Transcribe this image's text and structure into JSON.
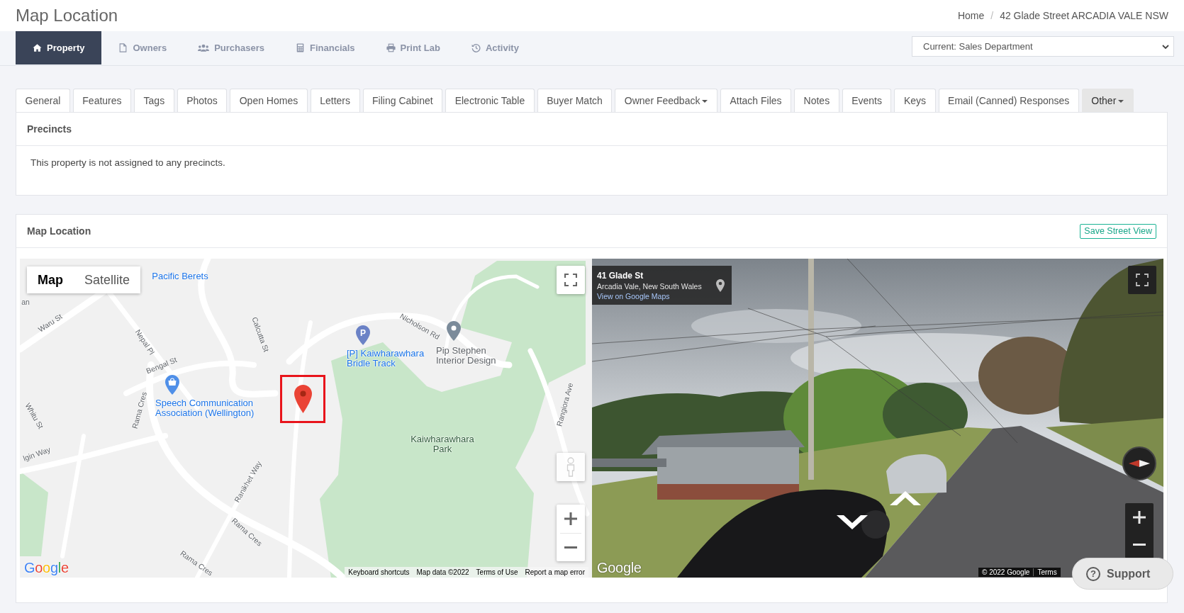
{
  "header": {
    "title": "Map Location",
    "breadcrumb": {
      "items": [
        "Home",
        "42 Glade Street ARCADIA VALE NSW"
      ],
      "separator": "/"
    }
  },
  "nav": {
    "items": [
      {
        "label": "Property",
        "selected": true
      },
      {
        "label": "Owners",
        "selected": false
      },
      {
        "label": "Purchasers",
        "selected": false
      },
      {
        "label": "Financials",
        "selected": false
      },
      {
        "label": "Print Lab",
        "selected": false
      },
      {
        "label": "Activity",
        "selected": false
      }
    ],
    "department_select": {
      "value": "Current: Sales Department"
    }
  },
  "tabs": [
    {
      "label": "General",
      "selected": false,
      "dropdown": false
    },
    {
      "label": "Features",
      "selected": false,
      "dropdown": false
    },
    {
      "label": "Tags",
      "selected": false,
      "dropdown": false
    },
    {
      "label": "Photos",
      "selected": false,
      "dropdown": false
    },
    {
      "label": "Open Homes",
      "selected": false,
      "dropdown": false
    },
    {
      "label": "Letters",
      "selected": false,
      "dropdown": false
    },
    {
      "label": "Filing Cabinet",
      "selected": false,
      "dropdown": false
    },
    {
      "label": "Electronic Table",
      "selected": false,
      "dropdown": false
    },
    {
      "label": "Buyer Match",
      "selected": false,
      "dropdown": false
    },
    {
      "label": "Owner Feedback",
      "selected": false,
      "dropdown": true
    },
    {
      "label": "Attach Files",
      "selected": false,
      "dropdown": false
    },
    {
      "label": "Notes",
      "selected": false,
      "dropdown": false
    },
    {
      "label": "Events",
      "selected": false,
      "dropdown": false
    },
    {
      "label": "Keys",
      "selected": false,
      "dropdown": false
    },
    {
      "label": "Email (Canned) Responses",
      "selected": false,
      "dropdown": false
    },
    {
      "label": "Other",
      "selected": true,
      "dropdown": true
    }
  ],
  "precincts": {
    "title": "Precincts",
    "message": "This property is not assigned to any precincts."
  },
  "map_location": {
    "title": "Map Location",
    "save_button": "Save Street View"
  },
  "map": {
    "type_buttons": [
      {
        "label": "Map",
        "selected": true
      },
      {
        "label": "Satellite",
        "selected": false
      }
    ],
    "labels": [
      {
        "text": "Pacific Berets",
        "kind": "poi"
      },
      {
        "text": "an",
        "kind": "street"
      },
      {
        "text": "Waru St",
        "kind": "street"
      },
      {
        "text": "Nepal Pl",
        "kind": "street"
      },
      {
        "text": "Calcutta St",
        "kind": "street"
      },
      {
        "text": "Nicholson Rd",
        "kind": "street"
      },
      {
        "text": "[P] Kaiwharawhara Bridle Track",
        "kind": "poi"
      },
      {
        "text": "Pip Stephen Interior Design",
        "kind": "place"
      },
      {
        "text": "Bengal St",
        "kind": "street"
      },
      {
        "text": "Speech Communication Association (Wellington)",
        "kind": "poi"
      },
      {
        "text": "Rama Cres",
        "kind": "street"
      },
      {
        "text": "Whitu St",
        "kind": "street"
      },
      {
        "text": "Kaiwharawhara Park",
        "kind": "park"
      },
      {
        "text": "Rangiora Ave",
        "kind": "street"
      },
      {
        "text": "lgin Way",
        "kind": "street"
      },
      {
        "text": "Ranikhet Way",
        "kind": "street"
      },
      {
        "text": "Rama Cres",
        "kind": "street"
      },
      {
        "text": "Rama Cres",
        "kind": "street"
      }
    ],
    "markers": [
      {
        "kind": "shop"
      },
      {
        "kind": "parking",
        "label": "P"
      },
      {
        "kind": "place"
      },
      {
        "kind": "property"
      }
    ],
    "logo": "Google",
    "footer_links": [
      "Keyboard shortcuts",
      "Map data ©2022",
      "Terms of Use",
      "Report a map error"
    ]
  },
  "street_view": {
    "address": "41 Glade St",
    "locality": "Arcadia Vale, New South Wales",
    "link": "View on Google Maps",
    "logo": "Google",
    "footer_links": [
      "© 2022 Google",
      "Terms"
    ]
  },
  "support": {
    "icon": "?",
    "label": "Support"
  }
}
